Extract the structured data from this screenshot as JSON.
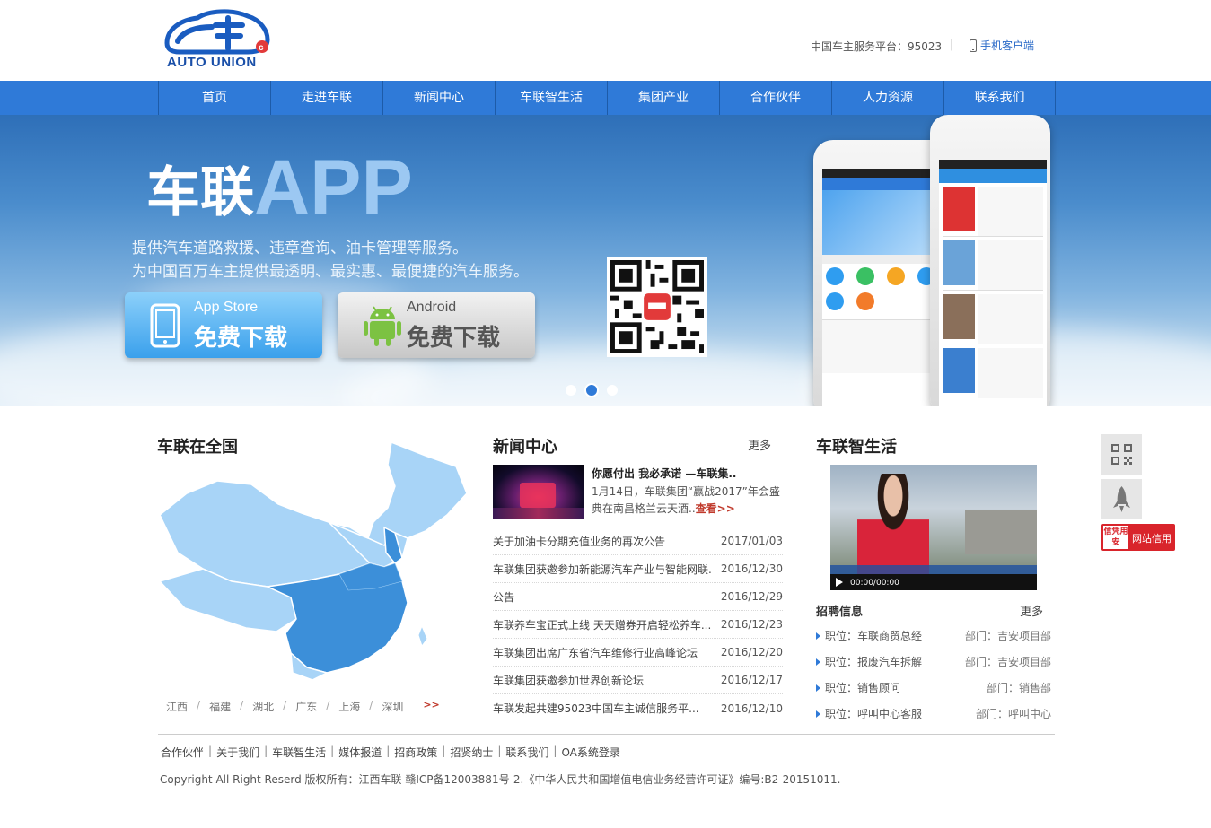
{
  "header": {
    "logo_text": "AUTO UNION",
    "hotline": "中国车主服务平台：95023",
    "separator": "|",
    "mobile_link": "手机客户端"
  },
  "nav": {
    "items": [
      "首页",
      "走进车联",
      "新闻中心",
      "车联智生活",
      "集团产业",
      "合作伙伴",
      "人力资源",
      "联系我们"
    ]
  },
  "banner": {
    "title_cn": "车联",
    "title_en": "APP",
    "line1": "提供汽车道路救援、违章查询、油卡管理等服务。",
    "line2": "为中国百万车主提供最透明、最实惠、最便捷的汽车服务。",
    "ios_label": "App Store",
    "ios_sub": "免费下载",
    "android_label": "Android",
    "android_sub": "免费下载",
    "slide_count": 3,
    "active_slide": 2
  },
  "national": {
    "title": "车联在全国",
    "cities": [
      "江西",
      "福建",
      "湖北",
      "广东",
      "上海",
      "深圳"
    ],
    "more_arrow": ">>"
  },
  "news": {
    "title": "新闻中心",
    "more": "更多",
    "top_title": "你愿付出 我必承诺 —车联集..",
    "top_desc": "1月14日，车联集团“赢战2017”年会盛典在南昌格兰云天酒..",
    "top_view": "查看>>",
    "items": [
      {
        "title": "关于加油卡分期充值业务的再次公告",
        "date": "2017/01/03"
      },
      {
        "title": "车联集团获邀参加新能源汽车产业与智能网联...",
        "date": "2016/12/30"
      },
      {
        "title": "公告",
        "date": "2016/12/29"
      },
      {
        "title": "车联养车宝正式上线 天天赠券开启轻松养车...",
        "date": "2016/12/23"
      },
      {
        "title": "车联集团出席广东省汽车维修行业高峰论坛",
        "date": "2016/12/20"
      },
      {
        "title": "车联集团获邀参加世界创新论坛",
        "date": "2016/12/17"
      },
      {
        "title": "车联发起共建95023中国车主诚信服务平...",
        "date": "2016/12/10"
      }
    ]
  },
  "life": {
    "title": "车联智生活",
    "video_time": "00:00/00:00"
  },
  "jobs": {
    "title": "招聘信息",
    "more": "更多",
    "items": [
      {
        "position": "职位：车联商贸总经",
        "dept": "部门：吉安项目部"
      },
      {
        "position": "职位：报废汽车拆解",
        "dept": "部门：吉安项目部"
      },
      {
        "position": "职位：销售顾问",
        "dept": "部门：销售部"
      },
      {
        "position": "职位：呼叫中心客服",
        "dept": "部门：呼叫中心"
      }
    ]
  },
  "side": {
    "credit_badge": "信凭用安",
    "credit_text": "网站信用"
  },
  "footer": {
    "links": [
      "合作伙伴",
      "关于我们",
      "车联智生活",
      "媒体报道",
      "招商政策",
      "招贤纳士",
      "联系我们",
      "OA系统登录"
    ],
    "copyright": "Copyright All Right Reserd 版权所有：江西车联 赣ICP备12003881号-2.《中华人民共和国增值电信业务经营许可证》编号:B2-20151011."
  },
  "colors": {
    "brand_blue": "#2f7ad8",
    "accent_red": "#c0392b",
    "map_light": "#a8d4f7",
    "map_dark": "#3c8fd9"
  }
}
